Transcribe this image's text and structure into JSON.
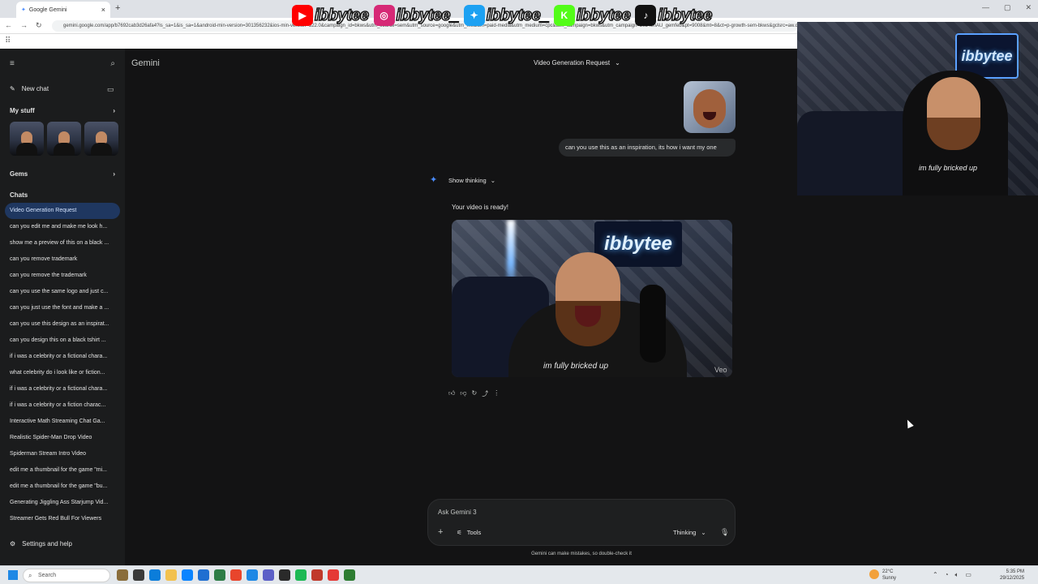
{
  "browser": {
    "tab_title": "Google Gemini",
    "new_tab": "+",
    "url": "gemini.google.com/app/b7692cab3d26afa4?is_sa=1&is_sa=1&android-min-version=301356232&ios-min-version=322.0&campaign_id=bkws&utm_source=sem&utm_source=google&utm_medium=paid-media&utm_medium=cpc&utm_campaign=bkws&utm_campaign=2024enAU_gemfeb&pt=9008&mt=8&ct=p-growth-sem-bkws&gclsrc=aw.ds&gad_source=1&gad_campaignid=20437330680"
  },
  "social_overlay": {
    "handles": [
      {
        "platform": "youtube",
        "icon": "youtube-icon",
        "color": "#ff0000",
        "glyph": "▶",
        "name": "ibbytee"
      },
      {
        "platform": "instagram",
        "icon": "instagram-icon",
        "color": "#d62976",
        "glyph": "◎",
        "name": "ibbytee_"
      },
      {
        "platform": "twitter",
        "icon": "twitter-icon",
        "color": "#1da1f2",
        "glyph": "✦",
        "name": "ibbytee_"
      },
      {
        "platform": "kick",
        "icon": "kick-icon",
        "color": "#53fc18",
        "glyph": "K",
        "name": "ibbytee"
      },
      {
        "platform": "tiktok",
        "icon": "tiktok-icon",
        "color": "#111111",
        "glyph": "♪",
        "name": "ibbytee"
      }
    ]
  },
  "webcam": {
    "neon_sign": "ibbytee",
    "shirt_text": "im fully bricked up"
  },
  "gemini": {
    "brand": "Gemini",
    "conversation_title": "Video Generation Request",
    "sidebar": {
      "new_chat": "New chat",
      "my_stuff": "My stuff",
      "gems": "Gems",
      "chats_header": "Chats",
      "settings": "Settings and help",
      "chats": [
        "Video Generation Request",
        "can you edit me and make me look h...",
        "show me a preview of this on a black ...",
        "can you remove trademark",
        "can you remove the trademark",
        "can you use the same logo and just c...",
        "can you just use the font and make a ...",
        "can you use this design as an inspirat...",
        "can you design this on a black tshirt ...",
        "if i was a celebrity or a fictional chara...",
        "what celebrity do i look like or fiction...",
        "if i was a celebrity or a fictional chara...",
        "if i was a celebrity or a fiction charac...",
        "Interactive Math Streaming Chat Ga...",
        "Realistic Spider-Man Drop Video",
        "Spiderman Stream Intro Video",
        "edit me a thumbnail for the game \"mi...",
        "edit me a thumbnail for the game \"bu...",
        "Generating Jiggling Ass Starjump Vid...",
        "Streamer Gets Red Bull For Viewers"
      ]
    },
    "user_message": "can you use this as an inspiration, its how i want my one",
    "show_thinking": "Show thinking",
    "response_text": "Your video is ready!",
    "video": {
      "neon_sign": "ibbytee",
      "shirt_text": "im fully bricked up",
      "watermark": "Veo"
    },
    "input": {
      "placeholder": "Ask Gemini 3",
      "tools": "Tools",
      "mode": "Thinking"
    },
    "disclaimer": "Gemini can make mistakes, so double-check it"
  },
  "taskbar": {
    "search_placeholder": "Search",
    "weather_temp": "22°C",
    "weather_desc": "Sunny",
    "time": "5:35 PM",
    "date": "29/12/2025",
    "icon_colors": [
      "#8a6d3b",
      "#3a3a3a",
      "#0b7dda",
      "#f2c14e",
      "#0a84ff",
      "#1f6fd1",
      "#2d7d46",
      "#e8452c",
      "#1e88e5",
      "#5b5fc7",
      "#2a2a2a",
      "#1db954",
      "#c0392b",
      "#e53935",
      "#2e7d32"
    ]
  }
}
